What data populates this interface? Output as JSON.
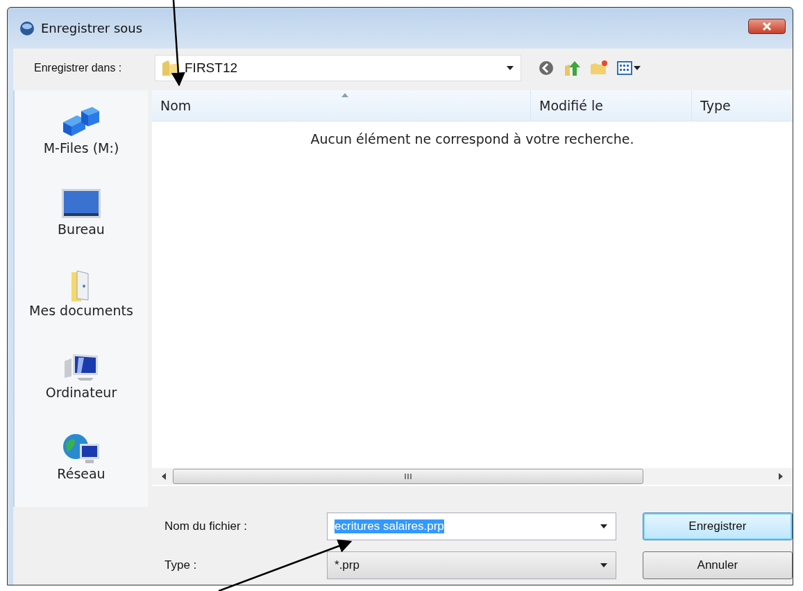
{
  "window": {
    "title": "Enregistrer sous"
  },
  "location": {
    "label": "Enregistrer dans :",
    "folder": "FIRST12"
  },
  "places": [
    {
      "label": "M-Files (M:)"
    },
    {
      "label": "Bureau"
    },
    {
      "label": "Mes documents"
    },
    {
      "label": "Ordinateur"
    },
    {
      "label": "Réseau"
    }
  ],
  "list": {
    "columns": [
      {
        "label": "Nom",
        "sorted": true
      },
      {
        "label": "Modifié le",
        "sorted": false
      },
      {
        "label": "Type",
        "sorted": false
      }
    ],
    "empty_message": "Aucun élément ne correspond à votre recherche."
  },
  "file_name": {
    "label": "Nom du fichier :",
    "value": "ecritures salaires.prp",
    "selected": true
  },
  "file_type": {
    "label": "Type :",
    "value": "*.prp"
  },
  "buttons": [
    {
      "label": "Enregistrer",
      "default": true
    },
    {
      "label": "Annuler",
      "default": false
    }
  ]
}
